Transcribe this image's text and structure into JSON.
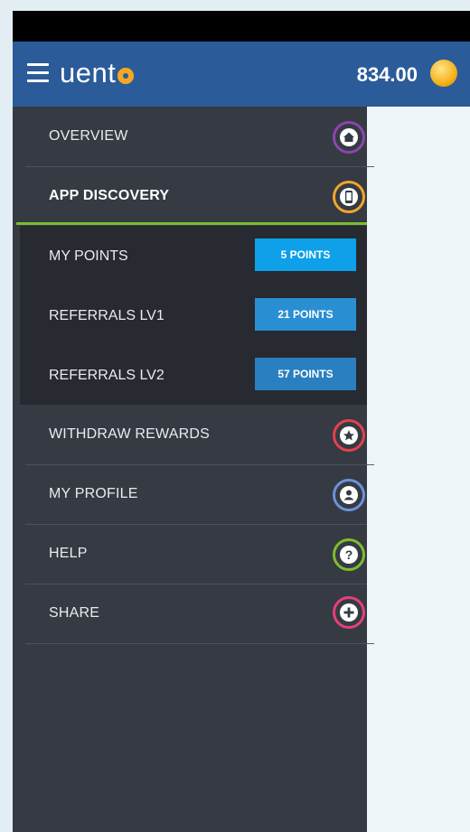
{
  "header": {
    "logo_text": "uent",
    "points_total": "834.00",
    "icons": {
      "menu": "hamburger-menu-icon",
      "coin": "coin-icon"
    }
  },
  "menu": {
    "overview": {
      "label": "OVERVIEW",
      "icon": "home-icon",
      "color": "#8e44ad"
    },
    "app_discovery": {
      "label": "APP DISCOVERY",
      "icon": "phone-icon",
      "color": "#f0a52a"
    },
    "my_points": {
      "label": "MY POINTS",
      "badge": "5 POINTS",
      "badge_color": "#0ea0e8"
    },
    "referrals_lv1": {
      "label": "REFERRALS LV1",
      "badge": "21 POINTS",
      "badge_color": "#2a8fd2"
    },
    "referrals_lv2": {
      "label": "REFERRALS LV2",
      "badge": "57 POINTS",
      "badge_color": "#2a7fc0"
    },
    "withdraw": {
      "label": "WITHDRAW REWARDS",
      "icon": "star-icon",
      "color": "#e5404f"
    },
    "profile": {
      "label": "MY PROFILE",
      "icon": "user-icon",
      "color": "#6a93d8"
    },
    "help": {
      "label": "HELP",
      "icon": "question-icon",
      "color": "#7dbd2e"
    },
    "share": {
      "label": "SHARE",
      "icon": "plus-icon",
      "color": "#e5407a"
    }
  }
}
